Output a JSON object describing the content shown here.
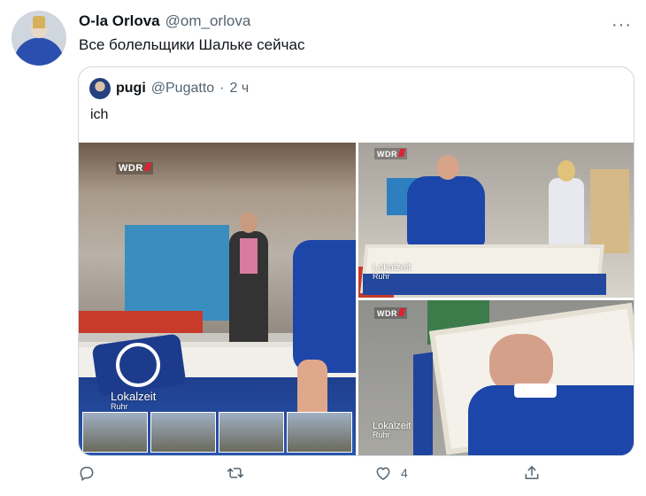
{
  "tweet": {
    "display_name": "O-la Orlova",
    "handle": "@om_orlova",
    "text": "Все болельщики Шальке сейчас",
    "more_icon": "more-horizontal-icon"
  },
  "quote": {
    "display_name": "pugi",
    "handle": "@Pugatto",
    "separator": "·",
    "time": "2 ч",
    "text": "ich"
  },
  "media": {
    "images": [
      {
        "channel": "WDR",
        "overlay": "Lokalzeit",
        "overlay_sub": "Ruhr"
      },
      {
        "channel": "WDR",
        "overlay": "Lokalzeit",
        "overlay_sub": "Ruhr"
      },
      {
        "channel": "WDR",
        "overlay": "Lokalzeit",
        "overlay_sub": "Ruhr"
      }
    ]
  },
  "actions": {
    "reply_icon": "reply-icon",
    "retweet_icon": "retweet-icon",
    "like_icon": "heart-icon",
    "like_count": "4",
    "share_icon": "share-icon"
  },
  "colors": {
    "text_primary": "#0f1419",
    "text_secondary": "#536471",
    "border": "#cfd9de",
    "schalke_blue": "#1d46aa"
  }
}
